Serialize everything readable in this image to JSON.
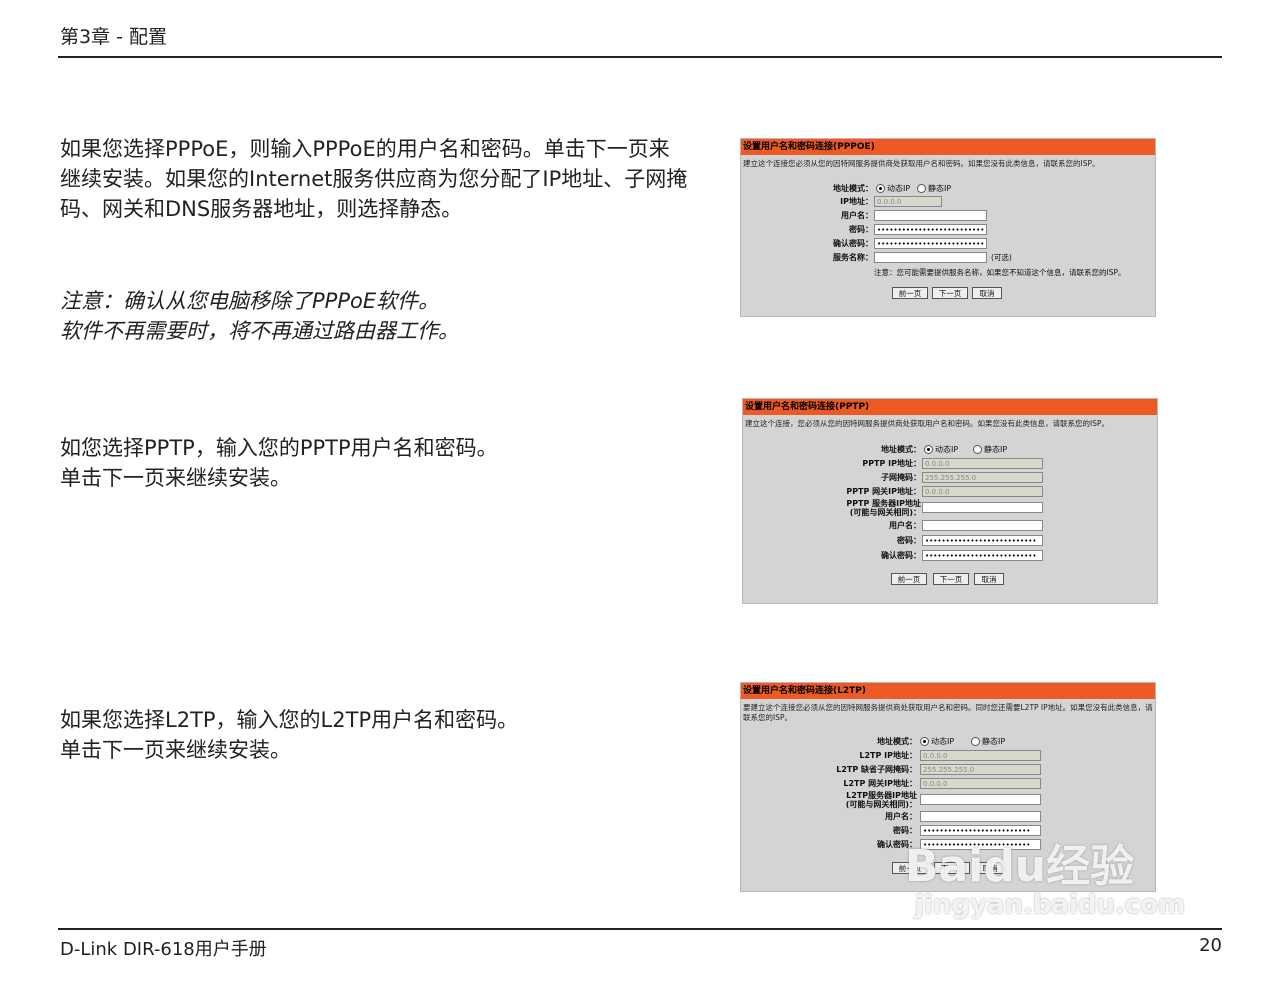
{
  "header": {
    "title": "第3章 - 配置"
  },
  "footer": {
    "left": "D-Link DIR-618用户手册",
    "page": "20"
  },
  "paragraphs": {
    "p1": [
      "如果您选择PPPoE，则输入PPPoE的用户名和密码。单击下一页来",
      "继续安装。如果您的Internet服务供应商为您分配了IP地址、子网掩",
      "码、网关和DNS服务器地址，则选择静态。"
    ],
    "note": [
      "注意：确认从您电脑移除了PPPoE软件。",
      "软件不再需要时，将不再通过路由器工作。"
    ],
    "p2": [
      "如您选择PPTP，输入您的PPTP用户名和密码。",
      "单击下一页来继续安装。"
    ],
    "p3": [
      "如果您选择L2TP，输入您的L2TP用户名和密码。",
      "单击下一页来继续安装。"
    ]
  },
  "shot_pppoe": {
    "title": "设置用户名和密码连接(PPPOE)",
    "desc": "建立这个连接您必须从您的因特网服务提供商处获取用户名和密码。如果您没有此类信息，请联系您的ISP。",
    "mode_label": "地址模式：",
    "radio_dynamic": "动态IP",
    "radio_static": "静态IP",
    "ip_label": "IP地址：",
    "ip_value": "0.0.0.0",
    "user_label": "用户名：",
    "pwd_label": "密码：",
    "pwd_value": "••••••••••••••••••••••••••",
    "confirm_label": "确认密码：",
    "confirm_value": "••••••••••••••••••••••••••",
    "service_label": "服务名称：",
    "service_suffix": "(可选)",
    "note": "注意：您可能需要提供服务名称，如果您不知道这个信息，请联系您的ISP。",
    "btn_prev": "前一页",
    "btn_next": "下一页",
    "btn_cancel": "取消"
  },
  "shot_pptp": {
    "title": "设置用户名和密码连接(PPTP)",
    "desc": "建立这个连接，您必须从您的因特网服务提供商处获取用户名和密码。如果您没有此类信息，请联系您的ISP。",
    "mode_label": "地址模式：",
    "radio_dynamic": "动态IP",
    "radio_static": "静态IP",
    "ip_label": "PPTP IP地址：",
    "ip_value": "0.0.0.0",
    "mask_label": "子网掩码：",
    "mask_value": "255.255.255.0",
    "gw_label": "PPTP 网关IP地址：",
    "gw_value": "0.0.0.0",
    "server_label_1": "PPTP 服务器IP地址",
    "server_label_2": "(可能与网关相同)：",
    "user_label": "用户名：",
    "pwd_label": "密码：",
    "pwd_value": "•••••••••••••••••••••••••••",
    "confirm_label": "确认密码：",
    "confirm_value": "•••••••••••••••••••••••••••",
    "btn_prev": "前一页",
    "btn_next": "下一页",
    "btn_cancel": "取消"
  },
  "shot_l2tp": {
    "title": "设置用户名和密码连接(L2TP)",
    "desc": "要建立这个连接您必须从您的因特网服务提供商处获取用户名和密码。同时您还需要L2TP IP地址。如果您没有此类信息，请联系您的ISP。",
    "mode_label": "地址模式：",
    "radio_dynamic": "动态IP",
    "radio_static": "静态IP",
    "ip_label": "L2TP IP地址：",
    "ip_value": "0.0.0.0",
    "mask_label": "L2TP 缺省子网掩码：",
    "mask_value": "255.255.255.0",
    "gw_label": "L2TP 网关IP地址：",
    "gw_value": "0.0.0.0",
    "server_label_1": "L2TP服务器IP地址",
    "server_label_2": "(可能与网关相同)：",
    "user_label": "用户名：",
    "pwd_label": "密码：",
    "pwd_value": "••••••••••••••••••••••••••",
    "confirm_label": "确认密码：",
    "confirm_value": "••••••••••••••••••••••••••",
    "btn_prev": "前一页",
    "btn_next": "下一页",
    "btn_cancel": "取消"
  },
  "watermark": {
    "logo": "Baidu经验",
    "url": "jingyan.baidu.com"
  },
  "colors": {
    "accent": "#ee5a24",
    "panel_bg": "#d4d4d4"
  }
}
